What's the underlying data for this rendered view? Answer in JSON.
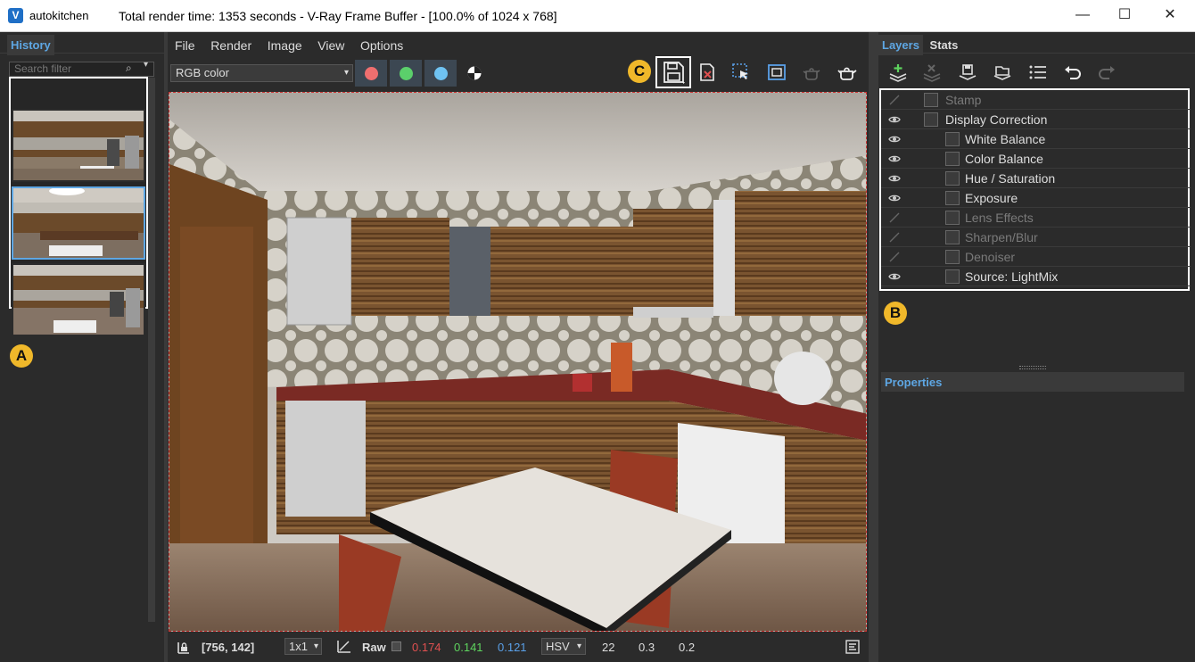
{
  "window": {
    "app_name": "autokitchen",
    "title": "Total render time: 1353 seconds - V-Ray Frame Buffer - [100.0% of 1024 x 768]",
    "logo_text": "V",
    "minimize": "—",
    "maximize": "☐",
    "close": "✕"
  },
  "history": {
    "tab_label": "History",
    "search_placeholder": "Search filter",
    "thumbnails": [
      "kitchen-render-1",
      "kitchen-render-2",
      "kitchen-render-3"
    ],
    "badge": "A"
  },
  "menu": [
    "File",
    "Render",
    "Image",
    "View",
    "Options"
  ],
  "toolbar": {
    "channel": "RGB color",
    "colors": {
      "red": "#ef6f6f",
      "green": "#5bcf6b",
      "blue": "#6fc3f2"
    },
    "badge": "C"
  },
  "status": {
    "coords": "[756, 142]",
    "zoom": "1x1",
    "mode": "Raw",
    "r": "0.174",
    "g": "0.141",
    "b": "0.121",
    "colorspace": "HSV",
    "h": "22",
    "s": "0.3",
    "v": "0.2",
    "colors": {
      "r": "#e05050",
      "g": "#5ed45e",
      "b": "#5aa0e8"
    }
  },
  "right": {
    "tabs": [
      "Layers",
      "Stats"
    ],
    "badge": "B",
    "properties_label": "Properties",
    "layers": [
      {
        "label": "Stamp",
        "visible": false,
        "indent": 0
      },
      {
        "label": "Display Correction",
        "visible": true,
        "indent": 0
      },
      {
        "label": "White Balance",
        "visible": true,
        "indent": 1
      },
      {
        "label": "Color Balance",
        "visible": true,
        "indent": 1
      },
      {
        "label": "Hue / Saturation",
        "visible": true,
        "indent": 1
      },
      {
        "label": "Exposure",
        "visible": true,
        "indent": 1
      },
      {
        "label": "Lens Effects",
        "visible": false,
        "indent": 1
      },
      {
        "label": "Sharpen/Blur",
        "visible": false,
        "indent": 1
      },
      {
        "label": "Denoiser",
        "visible": false,
        "indent": 1
      },
      {
        "label": "Source: LightMix",
        "visible": true,
        "indent": 1
      }
    ]
  }
}
